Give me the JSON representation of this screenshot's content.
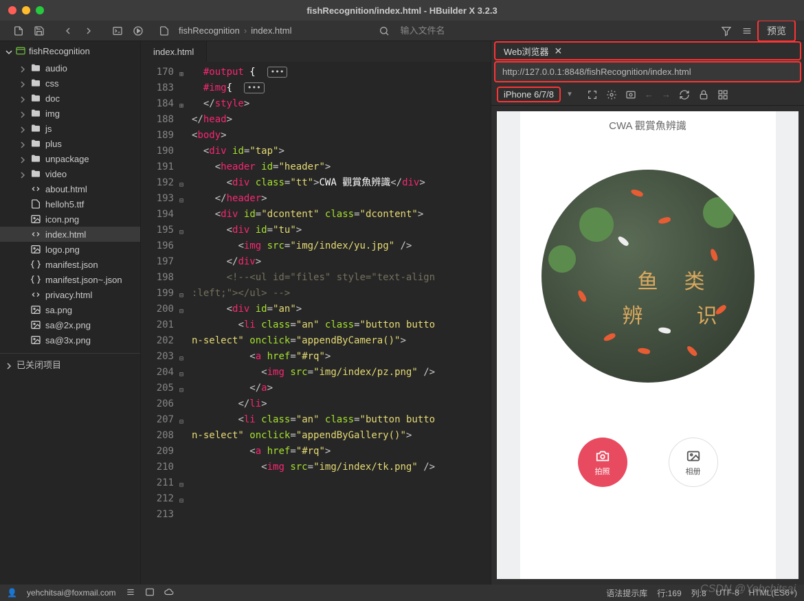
{
  "window": {
    "title": "fishRecognition/index.html - HBuilder X 3.2.3"
  },
  "toolbar": {
    "breadcrumb": [
      "fishRecognition",
      "index.html"
    ],
    "search_placeholder": "输入文件名",
    "preview_label": "预览"
  },
  "sidebar": {
    "root": "fishRecognition",
    "folders": [
      "audio",
      "css",
      "doc",
      "img",
      "js",
      "plus",
      "unpackage",
      "video"
    ],
    "files": [
      {
        "name": "about.html",
        "kind": "html"
      },
      {
        "name": "helloh5.ttf",
        "kind": "font"
      },
      {
        "name": "icon.png",
        "kind": "image"
      },
      {
        "name": "index.html",
        "kind": "html",
        "active": true
      },
      {
        "name": "logo.png",
        "kind": "image"
      },
      {
        "name": "manifest.json",
        "kind": "json"
      },
      {
        "name": "manifest.json~.json",
        "kind": "json"
      },
      {
        "name": "privacy.html",
        "kind": "html"
      },
      {
        "name": "sa.png",
        "kind": "image"
      },
      {
        "name": "sa@2x.png",
        "kind": "image"
      },
      {
        "name": "sa@3x.png",
        "kind": "image"
      }
    ],
    "closed_section": "已关闭项目"
  },
  "editor": {
    "tab": "index.html",
    "lines": [
      170,
      183,
      184,
      188,
      189,
      190,
      191,
      192,
      193,
      194,
      195,
      196,
      197,
      198,
      199,
      200,
      201,
      202,
      203,
      "",
      204,
      205,
      "",
      206,
      207,
      208,
      209,
      210,
      211,
      "",
      212,
      213
    ]
  },
  "code": {
    "l170": "#output ",
    "l184": "#img",
    "l188_tag": "style",
    "l191_tag": "head",
    "l192_tag": "body",
    "l193_tag": "div",
    "l193_id": "\"tap\"",
    "l195_tag": "header",
    "l195_id": "\"header\"",
    "l196_tag": "div",
    "l196_class": "\"tt\"",
    "l196_text": "CWA 觀賞魚辨識",
    "l197_tag": "header",
    "l199_tag": "div",
    "l199_id": "\"dcontent\"",
    "l199_class": "\"dcontent\"",
    "l200_tag": "div",
    "l200_id": "\"tu\"",
    "l201_tag": "img",
    "l201_src": "\"img/index/yu.jpg\"",
    "l202_tag": "div",
    "l203_comment": "<!--<ul id=\"files\" style=\"text-align:left;\"></ul> -->",
    "l204_tag": "div",
    "l204_id": "\"an\"",
    "l205_tag": "li",
    "l205_class1": "\"an\"",
    "l205_class2": "\"button button-select\"",
    "l205_onclick": "\"appendByCamera()\"",
    "l207_tag": "a",
    "l207_href": "\"#rq\"",
    "l208_tag": "img",
    "l208_src": "\"img/index/pz.png\"",
    "l209_tag": "a",
    "l210_tag": "li",
    "l211_tag": "li",
    "l211_class1": "\"an\"",
    "l211_class2": "\"button button-select\"",
    "l211_onclick": "\"appendByGallery()\"",
    "l212_tag": "a",
    "l212_href": "\"#rq\"",
    "l213_tag": "img",
    "l213_src": "\"img/index/tk.png\""
  },
  "preview": {
    "tab_label": "Web浏览器",
    "url": "http://127.0.0.1:8848/fishRecognition/index.html",
    "device": "iPhone 6/7/8",
    "app_title": "CWA 觀賞魚辨識",
    "pond_text": [
      "鱼",
      "类",
      "辨",
      "识"
    ],
    "btn_camera": "拍照",
    "btn_album": "相册"
  },
  "statusbar": {
    "user": "yehchitsai@foxmail.com",
    "syntax": "语法提示库",
    "line": "行:169",
    "col": "列:8",
    "encoding": "UTF-8",
    "lang": "HTML(ES6+)"
  },
  "watermark": "CSDN @Yehchitsai"
}
